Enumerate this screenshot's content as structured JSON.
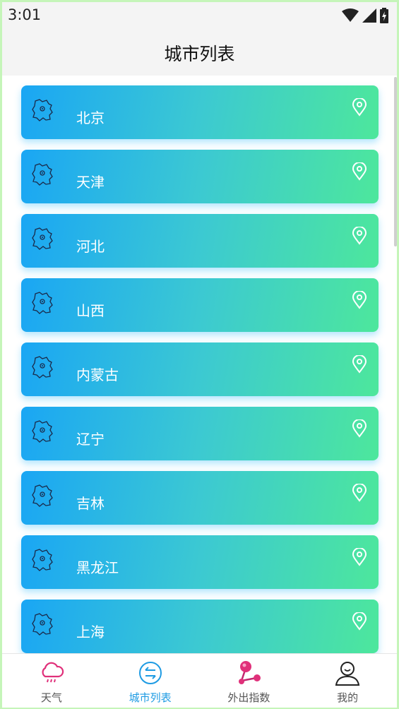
{
  "status_bar": {
    "time": "3:01"
  },
  "header": {
    "title": "城市列表"
  },
  "cities": [
    {
      "label": "北京"
    },
    {
      "label": "天津"
    },
    {
      "label": "河北"
    },
    {
      "label": "山西"
    },
    {
      "label": "内蒙古"
    },
    {
      "label": "辽宁"
    },
    {
      "label": "吉林"
    },
    {
      "label": "黑龙江"
    },
    {
      "label": "上海"
    }
  ],
  "bottom_nav": {
    "items": [
      {
        "label": "天气",
        "icon": "cloud-rain-icon"
      },
      {
        "label": "城市列表",
        "icon": "swap-arrows-icon",
        "active": true
      },
      {
        "label": "外出指数",
        "icon": "share-nodes-icon"
      },
      {
        "label": "我的",
        "icon": "user-icon"
      }
    ]
  },
  "colors": {
    "card_gradient_start": "#1aa6f4",
    "card_gradient_end": "#4de79c",
    "nav_active": "#1e9be3",
    "weather_icon": "#e0307a"
  }
}
